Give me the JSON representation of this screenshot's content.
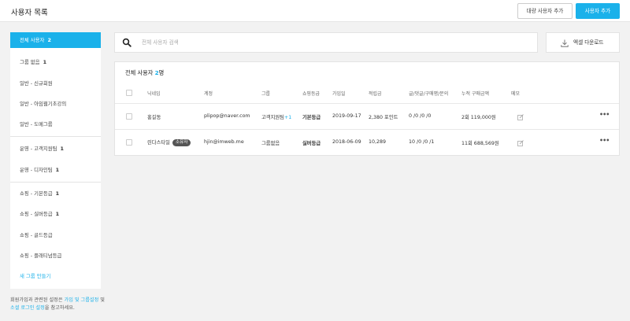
{
  "header": {
    "title": "사용자 목록",
    "bulk_add_label": "대량 사용자 추가",
    "add_user_label": "사용자 추가"
  },
  "sidebar": {
    "items": [
      {
        "label": "전체 사용자",
        "count": "2"
      },
      {
        "label": "그룹 없음",
        "count": "1"
      },
      {
        "label": "일반 - 신규회원",
        "count": ""
      },
      {
        "label": "일반 - 아임웹기초강의",
        "count": ""
      },
      {
        "label": "일반 - 도메그룹",
        "count": ""
      },
      {
        "label": "운영 - 고객지원팀",
        "count": "1"
      },
      {
        "label": "운영 - 디자인팀",
        "count": "1"
      },
      {
        "label": "쇼핑 - 기본등급",
        "count": "1"
      },
      {
        "label": "쇼핑 - 실버등급",
        "count": "1"
      },
      {
        "label": "쇼핑 - 골드등급",
        "count": ""
      },
      {
        "label": "쇼핑 - 플래티넘등급",
        "count": ""
      }
    ],
    "new_group_label": "새 그룹 만들기"
  },
  "help": {
    "prefix": "회원가입과 관련된 설정은 ",
    "link1": "가입 및 그룹설정",
    "mid": " 및 ",
    "link2": "소셜 로그인 설정",
    "suffix": "을 참고하세요."
  },
  "search": {
    "placeholder": "전체 사용자 검색"
  },
  "excel": {
    "label": "엑셀 다운로드"
  },
  "panel": {
    "title_prefix": "전체 사용자 ",
    "count": "2",
    "title_suffix": "명"
  },
  "table": {
    "headers": {
      "nickname": "닉네임",
      "account": "계정",
      "group": "그룹",
      "grade": "쇼핑등급",
      "joined": "가입일",
      "points": "적립금",
      "posts": "글/댓글/구매평/문의",
      "purchases": "누적 구매금액",
      "memo": "메모"
    },
    "rows": [
      {
        "nickname": "홍길동",
        "badge": "",
        "account": "plipop@naver.com",
        "group": "고객지원팀",
        "group_extra": "+1",
        "grade": "기본등급",
        "joined": "2019-09-17",
        "points": "2,380 포인트",
        "posts": "0 /0 /0 /0",
        "purchases": "2회 119,000원"
      },
      {
        "nickname": "린다스타일",
        "badge": "소유자",
        "account": "hjin@imweb.me",
        "group": "그룹없음",
        "group_extra": "",
        "grade": "실버등급",
        "joined": "2018-06-09",
        "points": "10,289",
        "posts": "10 /0 /0 /1",
        "purchases": "11회 688,569원"
      }
    ]
  },
  "colors": {
    "accent": "#1ab1ea",
    "badge": "#555555"
  },
  "icons": {
    "search": "search-icon",
    "download": "download-icon",
    "memo": "edit-icon",
    "more": "more-icon"
  }
}
